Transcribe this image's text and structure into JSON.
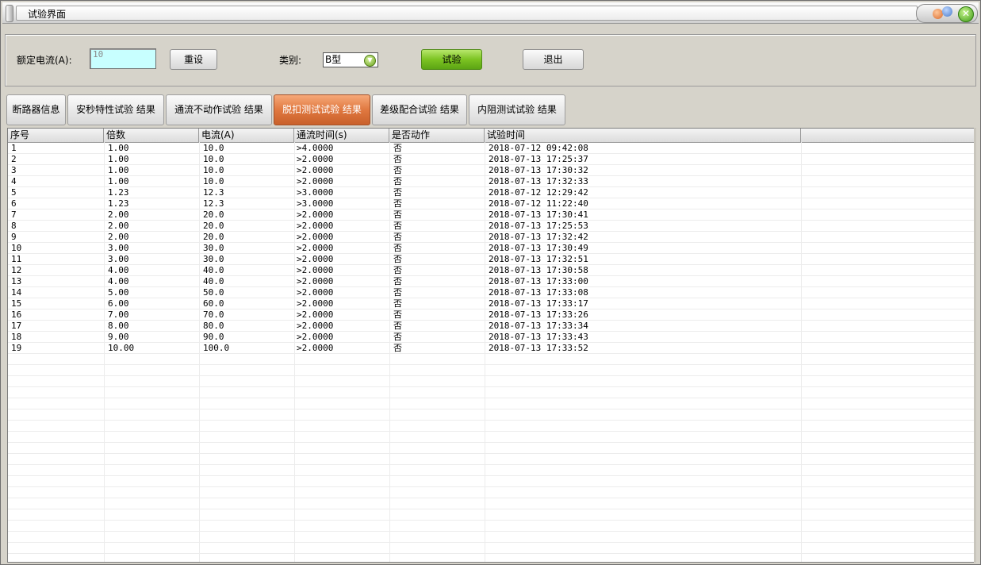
{
  "window": {
    "title": "试验界面",
    "close_icon": "✕"
  },
  "panel": {
    "rated_current_label": "额定电流(A):",
    "rated_current_value": "10",
    "reset_label": "重设",
    "category_label": "类别:",
    "category_selected": "B型",
    "test_label": "试验",
    "exit_label": "退出"
  },
  "tabs": [
    {
      "label": "断路器信息",
      "active": false
    },
    {
      "label": "安秒特性试验 结果",
      "active": false
    },
    {
      "label": "通流不动作试验 结果",
      "active": false
    },
    {
      "label": "脱扣测试试验 结果",
      "active": true
    },
    {
      "label": "差级配合试验 结果",
      "active": false
    },
    {
      "label": "内阻测试试验 结果",
      "active": false
    }
  ],
  "table": {
    "columns": [
      "序号",
      "倍数",
      "电流(A)",
      "通流时间(s)",
      "是否动作",
      "试验时间"
    ],
    "rows": [
      [
        "1",
        "1.00",
        "10.0",
        ">4.0000",
        "否",
        "2018-07-12 09:42:08"
      ],
      [
        "2",
        "1.00",
        "10.0",
        ">2.0000",
        "否",
        "2018-07-13 17:25:37"
      ],
      [
        "3",
        "1.00",
        "10.0",
        ">2.0000",
        "否",
        "2018-07-13 17:30:32"
      ],
      [
        "4",
        "1.00",
        "10.0",
        ">2.0000",
        "否",
        "2018-07-13 17:32:33"
      ],
      [
        "5",
        "1.23",
        "12.3",
        ">3.0000",
        "否",
        "2018-07-12 12:29:42"
      ],
      [
        "6",
        "1.23",
        "12.3",
        ">3.0000",
        "否",
        "2018-07-12 11:22:40"
      ],
      [
        "7",
        "2.00",
        "20.0",
        ">2.0000",
        "否",
        "2018-07-13 17:30:41"
      ],
      [
        "8",
        "2.00",
        "20.0",
        ">2.0000",
        "否",
        "2018-07-13 17:25:53"
      ],
      [
        "9",
        "2.00",
        "20.0",
        ">2.0000",
        "否",
        "2018-07-13 17:32:42"
      ],
      [
        "10",
        "3.00",
        "30.0",
        ">2.0000",
        "否",
        "2018-07-13 17:30:49"
      ],
      [
        "11",
        "3.00",
        "30.0",
        ">2.0000",
        "否",
        "2018-07-13 17:32:51"
      ],
      [
        "12",
        "4.00",
        "40.0",
        ">2.0000",
        "否",
        "2018-07-13 17:30:58"
      ],
      [
        "13",
        "4.00",
        "40.0",
        ">2.0000",
        "否",
        "2018-07-13 17:33:00"
      ],
      [
        "14",
        "5.00",
        "50.0",
        ">2.0000",
        "否",
        "2018-07-13 17:33:08"
      ],
      [
        "15",
        "6.00",
        "60.0",
        ">2.0000",
        "否",
        "2018-07-13 17:33:17"
      ],
      [
        "16",
        "7.00",
        "70.0",
        ">2.0000",
        "否",
        "2018-07-13 17:33:26"
      ],
      [
        "17",
        "8.00",
        "80.0",
        ">2.0000",
        "否",
        "2018-07-13 17:33:34"
      ],
      [
        "18",
        "9.00",
        "90.0",
        ">2.0000",
        "否",
        "2018-07-13 17:33:43"
      ],
      [
        "19",
        "10.00",
        "100.0",
        ">2.0000",
        "否",
        "2018-07-13 17:33:52"
      ]
    ]
  }
}
